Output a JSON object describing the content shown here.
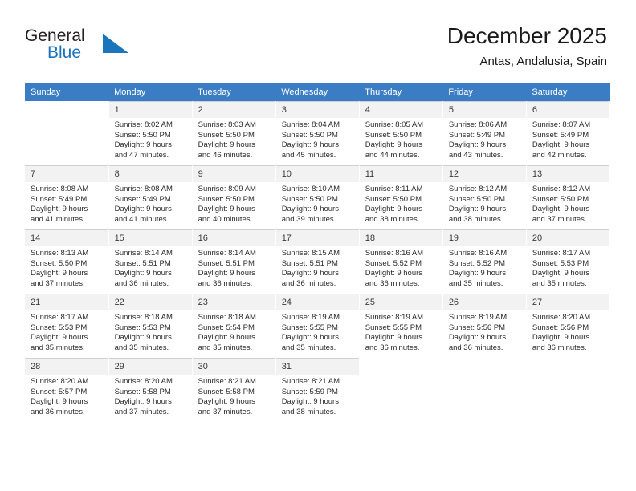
{
  "brand": {
    "name_part1": "General",
    "name_part2": "Blue",
    "triangle_color": "#1b75bb"
  },
  "header": {
    "title": "December 2025",
    "subtitle": "Antas, Andalusia, Spain"
  },
  "theme": {
    "header_row_bg": "#3b7dc4",
    "header_row_text": "#ffffff",
    "daynum_bg": "#f2f2f2",
    "cell_text": "#2b2b2b",
    "brand_blue": "#1b75bb"
  },
  "calendar": {
    "weekday_headers": [
      "Sunday",
      "Monday",
      "Tuesday",
      "Wednesday",
      "Thursday",
      "Friday",
      "Saturday"
    ],
    "weeks": [
      [
        {
          "day": "",
          "lines": [
            "",
            "",
            "",
            ""
          ]
        },
        {
          "day": "1",
          "lines": [
            "Sunrise: 8:02 AM",
            "Sunset: 5:50 PM",
            "Daylight: 9 hours",
            "and 47 minutes."
          ]
        },
        {
          "day": "2",
          "lines": [
            "Sunrise: 8:03 AM",
            "Sunset: 5:50 PM",
            "Daylight: 9 hours",
            "and 46 minutes."
          ]
        },
        {
          "day": "3",
          "lines": [
            "Sunrise: 8:04 AM",
            "Sunset: 5:50 PM",
            "Daylight: 9 hours",
            "and 45 minutes."
          ]
        },
        {
          "day": "4",
          "lines": [
            "Sunrise: 8:05 AM",
            "Sunset: 5:50 PM",
            "Daylight: 9 hours",
            "and 44 minutes."
          ]
        },
        {
          "day": "5",
          "lines": [
            "Sunrise: 8:06 AM",
            "Sunset: 5:49 PM",
            "Daylight: 9 hours",
            "and 43 minutes."
          ]
        },
        {
          "day": "6",
          "lines": [
            "Sunrise: 8:07 AM",
            "Sunset: 5:49 PM",
            "Daylight: 9 hours",
            "and 42 minutes."
          ]
        }
      ],
      [
        {
          "day": "7",
          "lines": [
            "Sunrise: 8:08 AM",
            "Sunset: 5:49 PM",
            "Daylight: 9 hours",
            "and 41 minutes."
          ]
        },
        {
          "day": "8",
          "lines": [
            "Sunrise: 8:08 AM",
            "Sunset: 5:49 PM",
            "Daylight: 9 hours",
            "and 41 minutes."
          ]
        },
        {
          "day": "9",
          "lines": [
            "Sunrise: 8:09 AM",
            "Sunset: 5:50 PM",
            "Daylight: 9 hours",
            "and 40 minutes."
          ]
        },
        {
          "day": "10",
          "lines": [
            "Sunrise: 8:10 AM",
            "Sunset: 5:50 PM",
            "Daylight: 9 hours",
            "and 39 minutes."
          ]
        },
        {
          "day": "11",
          "lines": [
            "Sunrise: 8:11 AM",
            "Sunset: 5:50 PM",
            "Daylight: 9 hours",
            "and 38 minutes."
          ]
        },
        {
          "day": "12",
          "lines": [
            "Sunrise: 8:12 AM",
            "Sunset: 5:50 PM",
            "Daylight: 9 hours",
            "and 38 minutes."
          ]
        },
        {
          "day": "13",
          "lines": [
            "Sunrise: 8:12 AM",
            "Sunset: 5:50 PM",
            "Daylight: 9 hours",
            "and 37 minutes."
          ]
        }
      ],
      [
        {
          "day": "14",
          "lines": [
            "Sunrise: 8:13 AM",
            "Sunset: 5:50 PM",
            "Daylight: 9 hours",
            "and 37 minutes."
          ]
        },
        {
          "day": "15",
          "lines": [
            "Sunrise: 8:14 AM",
            "Sunset: 5:51 PM",
            "Daylight: 9 hours",
            "and 36 minutes."
          ]
        },
        {
          "day": "16",
          "lines": [
            "Sunrise: 8:14 AM",
            "Sunset: 5:51 PM",
            "Daylight: 9 hours",
            "and 36 minutes."
          ]
        },
        {
          "day": "17",
          "lines": [
            "Sunrise: 8:15 AM",
            "Sunset: 5:51 PM",
            "Daylight: 9 hours",
            "and 36 minutes."
          ]
        },
        {
          "day": "18",
          "lines": [
            "Sunrise: 8:16 AM",
            "Sunset: 5:52 PM",
            "Daylight: 9 hours",
            "and 36 minutes."
          ]
        },
        {
          "day": "19",
          "lines": [
            "Sunrise: 8:16 AM",
            "Sunset: 5:52 PM",
            "Daylight: 9 hours",
            "and 35 minutes."
          ]
        },
        {
          "day": "20",
          "lines": [
            "Sunrise: 8:17 AM",
            "Sunset: 5:53 PM",
            "Daylight: 9 hours",
            "and 35 minutes."
          ]
        }
      ],
      [
        {
          "day": "21",
          "lines": [
            "Sunrise: 8:17 AM",
            "Sunset: 5:53 PM",
            "Daylight: 9 hours",
            "and 35 minutes."
          ]
        },
        {
          "day": "22",
          "lines": [
            "Sunrise: 8:18 AM",
            "Sunset: 5:53 PM",
            "Daylight: 9 hours",
            "and 35 minutes."
          ]
        },
        {
          "day": "23",
          "lines": [
            "Sunrise: 8:18 AM",
            "Sunset: 5:54 PM",
            "Daylight: 9 hours",
            "and 35 minutes."
          ]
        },
        {
          "day": "24",
          "lines": [
            "Sunrise: 8:19 AM",
            "Sunset: 5:55 PM",
            "Daylight: 9 hours",
            "and 35 minutes."
          ]
        },
        {
          "day": "25",
          "lines": [
            "Sunrise: 8:19 AM",
            "Sunset: 5:55 PM",
            "Daylight: 9 hours",
            "and 36 minutes."
          ]
        },
        {
          "day": "26",
          "lines": [
            "Sunrise: 8:19 AM",
            "Sunset: 5:56 PM",
            "Daylight: 9 hours",
            "and 36 minutes."
          ]
        },
        {
          "day": "27",
          "lines": [
            "Sunrise: 8:20 AM",
            "Sunset: 5:56 PM",
            "Daylight: 9 hours",
            "and 36 minutes."
          ]
        }
      ],
      [
        {
          "day": "28",
          "lines": [
            "Sunrise: 8:20 AM",
            "Sunset: 5:57 PM",
            "Daylight: 9 hours",
            "and 36 minutes."
          ]
        },
        {
          "day": "29",
          "lines": [
            "Sunrise: 8:20 AM",
            "Sunset: 5:58 PM",
            "Daylight: 9 hours",
            "and 37 minutes."
          ]
        },
        {
          "day": "30",
          "lines": [
            "Sunrise: 8:21 AM",
            "Sunset: 5:58 PM",
            "Daylight: 9 hours",
            "and 37 minutes."
          ]
        },
        {
          "day": "31",
          "lines": [
            "Sunrise: 8:21 AM",
            "Sunset: 5:59 PM",
            "Daylight: 9 hours",
            "and 38 minutes."
          ]
        },
        {
          "day": "",
          "lines": [
            "",
            "",
            "",
            ""
          ]
        },
        {
          "day": "",
          "lines": [
            "",
            "",
            "",
            ""
          ]
        },
        {
          "day": "",
          "lines": [
            "",
            "",
            "",
            ""
          ]
        }
      ]
    ]
  }
}
